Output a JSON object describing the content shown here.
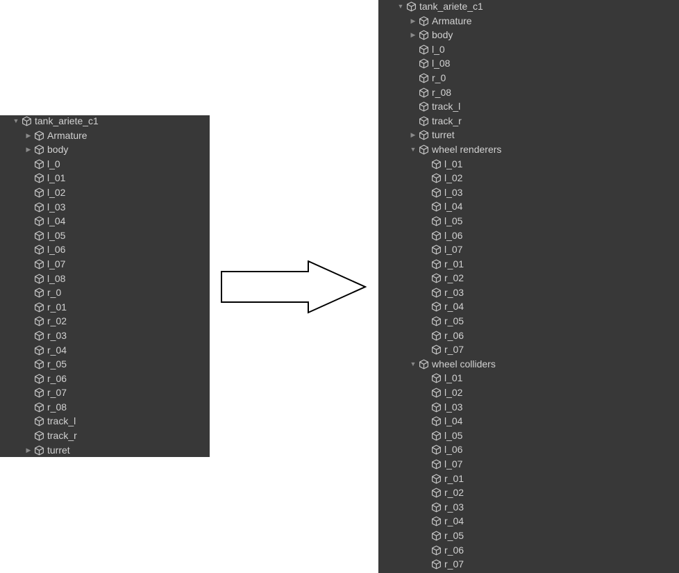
{
  "colors": {
    "panel_bg": "#383838",
    "text": "#d2d2d2",
    "icon": "#c4c4c4",
    "foldout": "#8a8a8a"
  },
  "icons": {
    "object": "cube-icon",
    "foldout_expanded": "triangle-down-icon",
    "foldout_collapsed": "triangle-right-icon",
    "transition": "right-arrow-icon"
  },
  "before": {
    "items": [
      {
        "label": "tank_ariete_c1",
        "depth": 0,
        "fold": "expanded"
      },
      {
        "label": "Armature",
        "depth": 1,
        "fold": "collapsed"
      },
      {
        "label": "body",
        "depth": 1,
        "fold": "collapsed"
      },
      {
        "label": "l_0",
        "depth": 1,
        "fold": "none"
      },
      {
        "label": "l_01",
        "depth": 1,
        "fold": "none"
      },
      {
        "label": "l_02",
        "depth": 1,
        "fold": "none"
      },
      {
        "label": "l_03",
        "depth": 1,
        "fold": "none"
      },
      {
        "label": "l_04",
        "depth": 1,
        "fold": "none"
      },
      {
        "label": "l_05",
        "depth": 1,
        "fold": "none"
      },
      {
        "label": "l_06",
        "depth": 1,
        "fold": "none"
      },
      {
        "label": "l_07",
        "depth": 1,
        "fold": "none"
      },
      {
        "label": "l_08",
        "depth": 1,
        "fold": "none"
      },
      {
        "label": "r_0",
        "depth": 1,
        "fold": "none"
      },
      {
        "label": "r_01",
        "depth": 1,
        "fold": "none"
      },
      {
        "label": "r_02",
        "depth": 1,
        "fold": "none"
      },
      {
        "label": "r_03",
        "depth": 1,
        "fold": "none"
      },
      {
        "label": "r_04",
        "depth": 1,
        "fold": "none"
      },
      {
        "label": "r_05",
        "depth": 1,
        "fold": "none"
      },
      {
        "label": "r_06",
        "depth": 1,
        "fold": "none"
      },
      {
        "label": "r_07",
        "depth": 1,
        "fold": "none"
      },
      {
        "label": "r_08",
        "depth": 1,
        "fold": "none"
      },
      {
        "label": "track_l",
        "depth": 1,
        "fold": "none"
      },
      {
        "label": "track_r",
        "depth": 1,
        "fold": "none"
      },
      {
        "label": "turret",
        "depth": 1,
        "fold": "collapsed"
      }
    ]
  },
  "after": {
    "items": [
      {
        "label": "tank_ariete_c1",
        "depth": 0,
        "fold": "expanded"
      },
      {
        "label": "Armature",
        "depth": 1,
        "fold": "collapsed"
      },
      {
        "label": "body",
        "depth": 1,
        "fold": "collapsed"
      },
      {
        "label": "l_0",
        "depth": 1,
        "fold": "none"
      },
      {
        "label": "l_08",
        "depth": 1,
        "fold": "none"
      },
      {
        "label": "r_0",
        "depth": 1,
        "fold": "none"
      },
      {
        "label": "r_08",
        "depth": 1,
        "fold": "none"
      },
      {
        "label": "track_l",
        "depth": 1,
        "fold": "none"
      },
      {
        "label": "track_r",
        "depth": 1,
        "fold": "none"
      },
      {
        "label": "turret",
        "depth": 1,
        "fold": "collapsed"
      },
      {
        "label": "wheel renderers",
        "depth": 1,
        "fold": "expanded"
      },
      {
        "label": "l_01",
        "depth": 2,
        "fold": "none"
      },
      {
        "label": "l_02",
        "depth": 2,
        "fold": "none"
      },
      {
        "label": "l_03",
        "depth": 2,
        "fold": "none"
      },
      {
        "label": "l_04",
        "depth": 2,
        "fold": "none"
      },
      {
        "label": "l_05",
        "depth": 2,
        "fold": "none"
      },
      {
        "label": "l_06",
        "depth": 2,
        "fold": "none"
      },
      {
        "label": "l_07",
        "depth": 2,
        "fold": "none"
      },
      {
        "label": "r_01",
        "depth": 2,
        "fold": "none"
      },
      {
        "label": "r_02",
        "depth": 2,
        "fold": "none"
      },
      {
        "label": "r_03",
        "depth": 2,
        "fold": "none"
      },
      {
        "label": "r_04",
        "depth": 2,
        "fold": "none"
      },
      {
        "label": "r_05",
        "depth": 2,
        "fold": "none"
      },
      {
        "label": "r_06",
        "depth": 2,
        "fold": "none"
      },
      {
        "label": "r_07",
        "depth": 2,
        "fold": "none"
      },
      {
        "label": "wheel colliders",
        "depth": 1,
        "fold": "expanded"
      },
      {
        "label": "l_01",
        "depth": 2,
        "fold": "none"
      },
      {
        "label": "l_02",
        "depth": 2,
        "fold": "none"
      },
      {
        "label": "l_03",
        "depth": 2,
        "fold": "none"
      },
      {
        "label": "l_04",
        "depth": 2,
        "fold": "none"
      },
      {
        "label": "l_05",
        "depth": 2,
        "fold": "none"
      },
      {
        "label": "l_06",
        "depth": 2,
        "fold": "none"
      },
      {
        "label": "l_07",
        "depth": 2,
        "fold": "none"
      },
      {
        "label": "r_01",
        "depth": 2,
        "fold": "none"
      },
      {
        "label": "r_02",
        "depth": 2,
        "fold": "none"
      },
      {
        "label": "r_03",
        "depth": 2,
        "fold": "none"
      },
      {
        "label": "r_04",
        "depth": 2,
        "fold": "none"
      },
      {
        "label": "r_05",
        "depth": 2,
        "fold": "none"
      },
      {
        "label": "r_06",
        "depth": 2,
        "fold": "none"
      },
      {
        "label": "r_07",
        "depth": 2,
        "fold": "none"
      }
    ]
  }
}
